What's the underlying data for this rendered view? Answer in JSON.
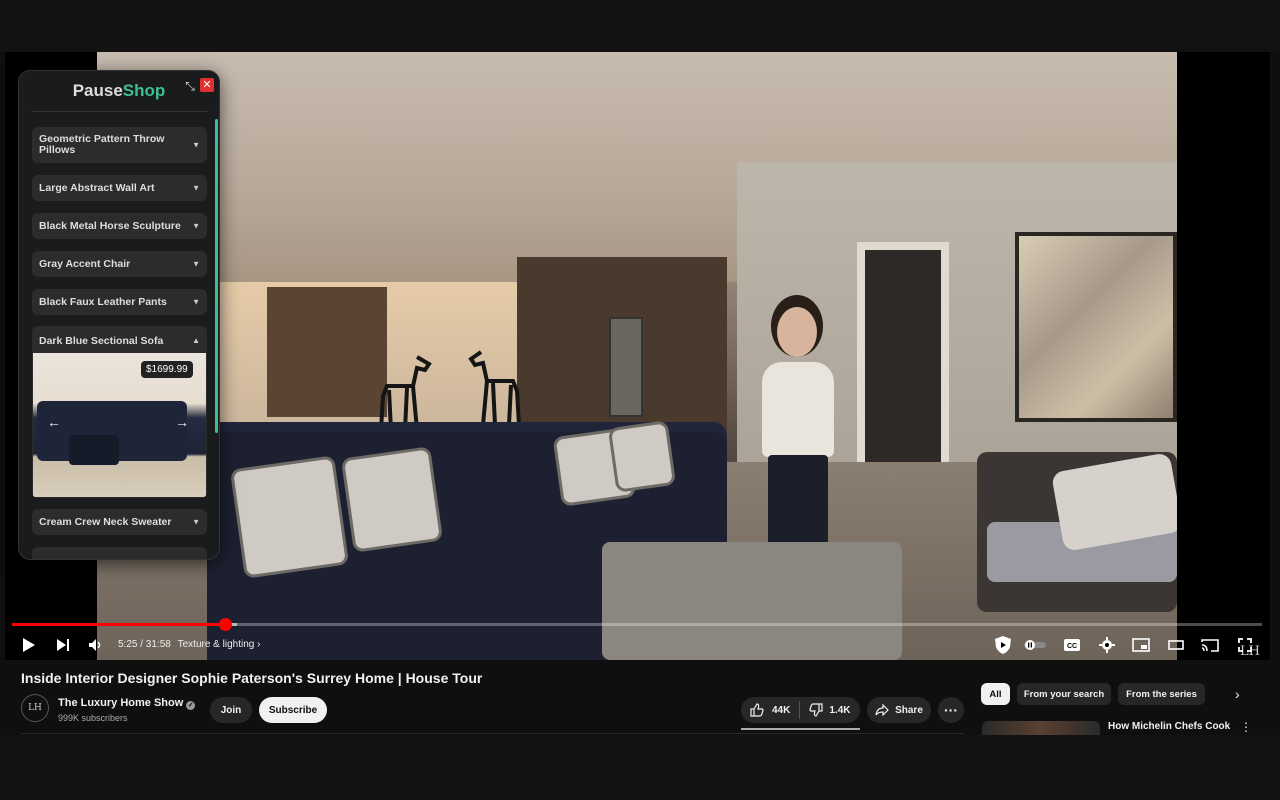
{
  "player": {
    "current_time": "5:25",
    "duration": "31:58",
    "time_display": "5:25 / 31:58",
    "chapter": "Texture & lighting",
    "chapter_arrow": "›",
    "progress_fraction": 0.17,
    "watermark": "LH"
  },
  "extension": {
    "brand_part1": "Pause",
    "brand_part2": "Shop",
    "brand_accent": "#3dbf95",
    "minimize_symbol": "⤡",
    "close_symbol": "✕",
    "items": [
      {
        "label": "Geometric Pattern Throw Pillows",
        "arrow": "▼"
      },
      {
        "label": "Large Abstract Wall Art",
        "arrow": "▼"
      },
      {
        "label": "Black Metal Horse Sculpture",
        "arrow": "▼"
      },
      {
        "label": "Gray Accent Chair",
        "arrow": "▼"
      },
      {
        "label": "Black Faux Leather Pants",
        "arrow": "▼"
      },
      {
        "label": "Dark Blue Sectional Sofa",
        "arrow": "▲",
        "price": "$1699.99",
        "prev": "←",
        "next": "→"
      },
      {
        "label": "Cream Crew Neck Sweater",
        "arrow": "▼"
      }
    ]
  },
  "video": {
    "title": "Inside Interior Designer Sophie Paterson's Surrey Home | House Tour",
    "channel_name": "The Luxury Home Show",
    "channel_avatar_text": "LH",
    "verified_symbol": "✓",
    "subscribers": "999K subscribers",
    "join_label": "Join",
    "subscribe_label": "Subscribe",
    "likes": "44K",
    "dislikes": "1.4K",
    "share_label": "Share",
    "more_symbol": "···"
  },
  "sidebar": {
    "chips": [
      "All",
      "From your search",
      "From the series"
    ],
    "active_chip": "All",
    "next_symbol": "›",
    "recommendation_title": "How Michelin Chefs Cook",
    "rec_more_symbol": "⋮"
  },
  "colors": {
    "progress_played": "#ff0000",
    "subscribe_bg": "#f1f1f1",
    "close_button": "#e03131"
  }
}
